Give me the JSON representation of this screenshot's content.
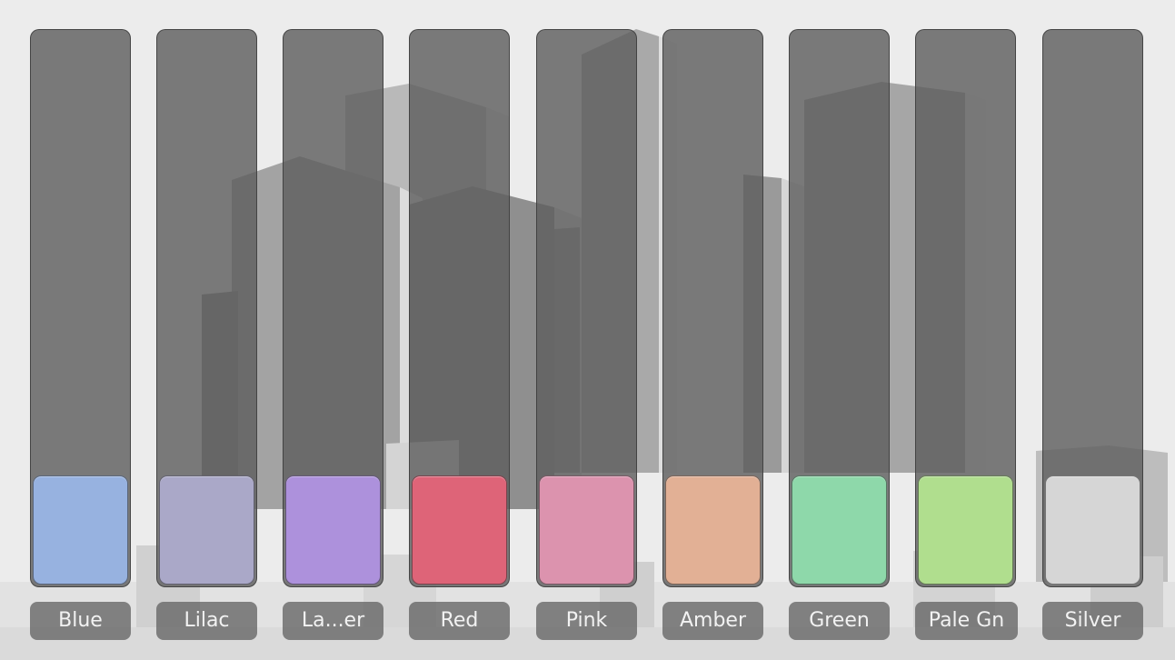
{
  "palette": {
    "items": [
      {
        "label": "Blue",
        "color": "#97b2e0"
      },
      {
        "label": "Lilac",
        "color": "#aaa8c8"
      },
      {
        "label": "La...er",
        "color": "#ad91dc"
      },
      {
        "label": "Red",
        "color": "#de6478"
      },
      {
        "label": "Pink",
        "color": "#dc93ae"
      },
      {
        "label": "Amber",
        "color": "#e2b095"
      },
      {
        "label": "Green",
        "color": "#8ed8aa"
      },
      {
        "label": "Pale Gn",
        "color": "#b0de8e"
      },
      {
        "label": "Silver",
        "color": "#d6d6d6"
      }
    ]
  }
}
